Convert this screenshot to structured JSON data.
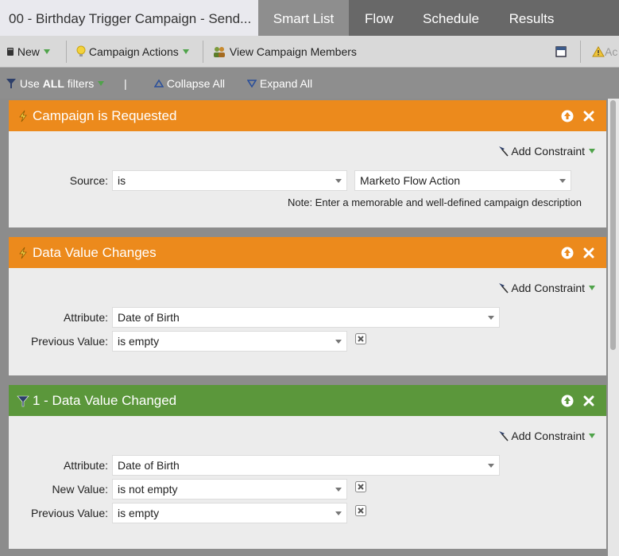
{
  "tabs": {
    "title": "00 - Birthday Trigger Campaign - Send...",
    "items": [
      "Smart List",
      "Flow",
      "Schedule",
      "Results"
    ],
    "active": "Smart List"
  },
  "toolbar": {
    "new_label": "New",
    "campaign_actions_label": "Campaign Actions",
    "view_members_label": "View Campaign Members",
    "activate_label": "Ac"
  },
  "filterbar": {
    "use_prefix": "Use",
    "use_all": "ALL",
    "use_suffix": "filters",
    "separator": "|",
    "collapse_label": "Collapse All",
    "expand_label": "Expand All"
  },
  "colors": {
    "trigger_header": "#ec8a1c",
    "filter_header": "#5b973b"
  },
  "cards": [
    {
      "title": "Campaign is Requested",
      "add_constraint": "Add Constraint",
      "source_label": "Source:",
      "source_op": "is",
      "source_value": "Marketo Flow Action",
      "note": "Note: Enter a memorable and well-defined campaign description"
    },
    {
      "title": "Data Value Changes",
      "add_constraint": "Add Constraint",
      "attribute_label": "Attribute:",
      "attribute_value": "Date of Birth",
      "previous_label": "Previous Value:",
      "previous_value": "is empty"
    },
    {
      "title": "1 - Data Value Changed",
      "add_constraint": "Add Constraint",
      "attribute_label": "Attribute:",
      "attribute_value": "Date of Birth",
      "new_label": "New Value:",
      "new_value": "is not empty",
      "previous_label": "Previous Value:",
      "previous_value": "is empty"
    }
  ]
}
